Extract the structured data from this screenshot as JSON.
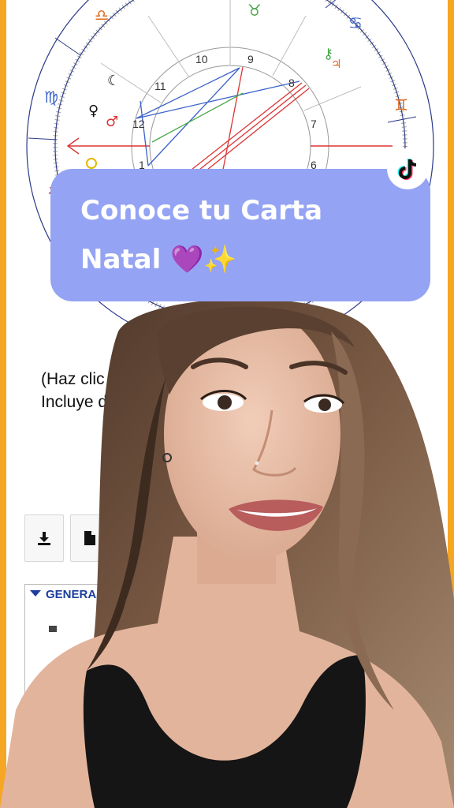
{
  "chart": {
    "house_numbers": [
      "10",
      "11",
      "12",
      "9",
      "8",
      "7",
      "6",
      "1"
    ],
    "sign_symbols": [
      "♎",
      "♉",
      "♋",
      "♍",
      "♊",
      "♐"
    ],
    "planet_symbols": [
      "☾",
      "♀",
      "♂",
      "⚷",
      "♃"
    ]
  },
  "caption": {
    "line1": "(Haz clic",
    "line2": "Incluye da"
  },
  "section": {
    "title": "GENERA"
  },
  "banner": {
    "line1": "Conoce tu Carta",
    "line2": "Natal 💜✨"
  },
  "icons": {
    "download": "download-icon",
    "document": "document-icon",
    "tiktok": "tiktok-logo-icon"
  },
  "colors": {
    "frame": "#f5a623",
    "banner": "#94a3f3",
    "link_blue": "#1c3f9e"
  }
}
